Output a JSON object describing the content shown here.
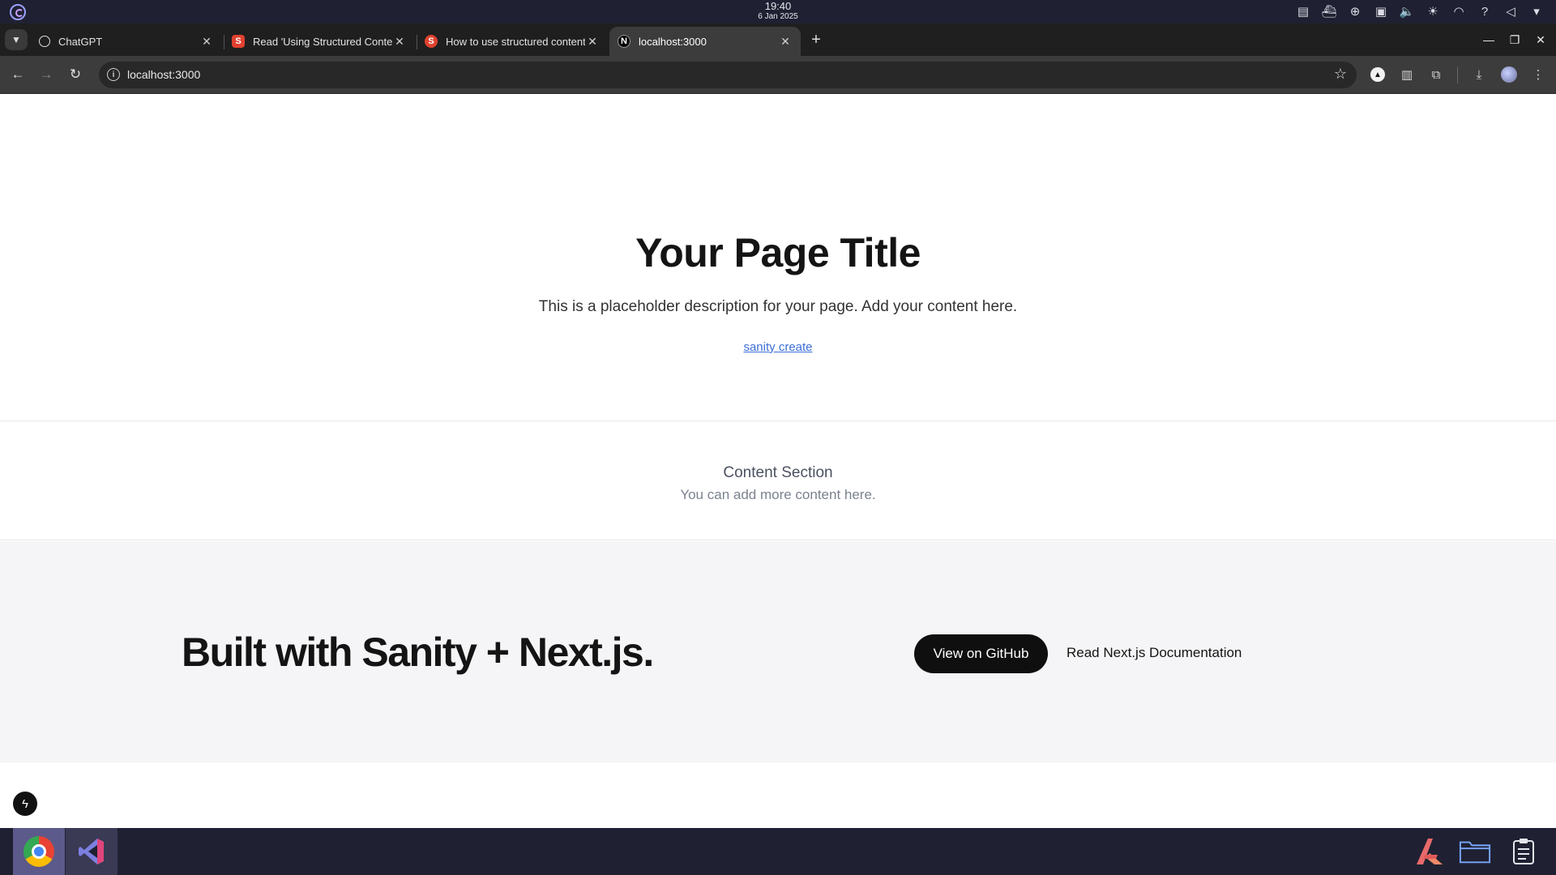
{
  "system": {
    "time": "19:40",
    "date": "6 Jan 2025",
    "tray_icons": [
      "notes-icon",
      "docker-icon",
      "update-icon",
      "clipboard-icon",
      "volume-icon",
      "brightness-icon",
      "wifi-icon",
      "help-icon",
      "speaker-icon",
      "menu-chevron-icon"
    ]
  },
  "browser": {
    "tabs": [
      {
        "title": "ChatGPT",
        "favicon": "chatgpt-icon",
        "active": false
      },
      {
        "title": "Read 'Using Structured Content",
        "favicon": "sanity-icon",
        "active": false
      },
      {
        "title": "How to use structured content",
        "favicon": "sanity-icon",
        "active": false
      },
      {
        "title": "localhost:3000",
        "favicon": "nextjs-icon",
        "active": true
      }
    ],
    "url": "localhost:3000"
  },
  "page": {
    "hero": {
      "title": "Your Page Title",
      "description": "This is a placeholder description for your page. Add your content here.",
      "link": "sanity create"
    },
    "content": {
      "heading": "Content Section",
      "text": "You can add more content here."
    },
    "footer": {
      "headline": "Built with Sanity + Next.js.",
      "github_button": "View on GitHub",
      "docs_link": "Read Next.js Documentation"
    }
  },
  "colors": {
    "link": "#3b6fd8",
    "button_bg": "#0f0f10",
    "footer_bg": "#f5f5f7",
    "taskbar_bg": "#1f2132"
  }
}
